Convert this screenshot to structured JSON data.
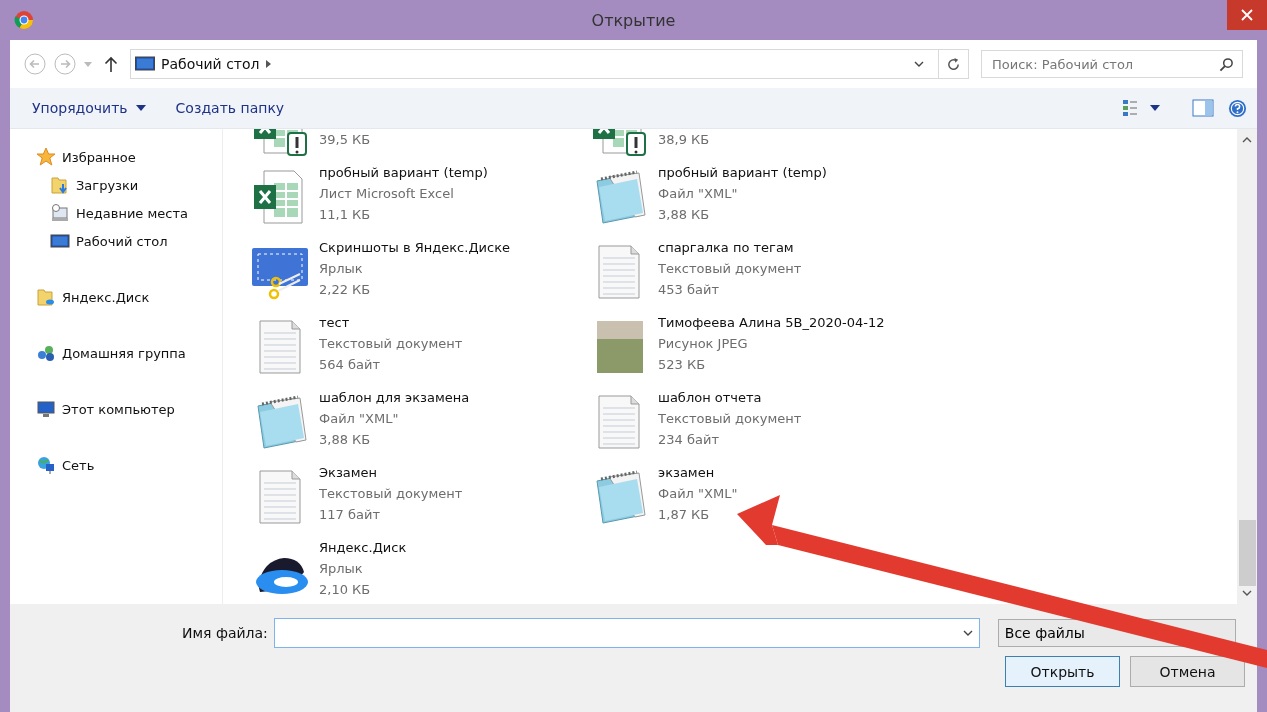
{
  "window": {
    "title": "Открытие"
  },
  "nav": {
    "path": "Рабочий стол",
    "search": {
      "placeholder": "Поиск: Рабочий стол"
    }
  },
  "toolbar": {
    "buttons": [
      {
        "label": "Упорядочить",
        "kind": "menu"
      },
      {
        "label": "Создать папку",
        "kind": "plain"
      }
    ]
  },
  "sidebar": {
    "items": [
      {
        "label": "Избранное",
        "kind": "star",
        "children": [
          {
            "label": "Загрузки",
            "kind": "downloads"
          },
          {
            "label": "Недавние места",
            "kind": "recent"
          },
          {
            "label": "Рабочий стол",
            "kind": "desktop"
          }
        ]
      },
      {
        "label": "Яндекс.Диск",
        "kind": "cloudfolder"
      },
      {
        "label": "Домашняя группа",
        "kind": "homegroup"
      },
      {
        "label": "Этот компьютер",
        "kind": "computer"
      },
      {
        "label": "Сеть",
        "kind": "network"
      }
    ]
  },
  "files": [
    {
      "kind": "excel-warning",
      "size": "39,5 КБ"
    },
    {
      "kind": "excel-warning",
      "size": "38,9 КБ"
    },
    {
      "kind": "excel",
      "name": "пробный вариант (temp)",
      "type": "Лист Microsoft Excel",
      "size": "11,1 КБ"
    },
    {
      "kind": "xml",
      "name": "пробный вариант (temp)",
      "type": "Файл \"XML\"",
      "size": "3,88 КБ"
    },
    {
      "kind": "screenshot-shortcut",
      "name": "Скриншоты в Яндекс.Диске",
      "type": "Ярлык",
      "size": "2,22 КБ"
    },
    {
      "kind": "text",
      "name": "спаргалка по тегам",
      "type": "Текстовый документ",
      "size": "453 байт"
    },
    {
      "kind": "text",
      "name": "тест",
      "type": "Текстовый документ",
      "size": "564 байт"
    },
    {
      "kind": "image",
      "name": "Тимофеева Алина 5В_2020-04-12",
      "type": "Рисунок JPEG",
      "size": "523 КБ"
    },
    {
      "kind": "xml",
      "name": "шаблон для экзамена",
      "type": "Файл \"XML\"",
      "size": "3,88 КБ"
    },
    {
      "kind": "text",
      "name": "шаблон отчета",
      "type": "Текстовый документ",
      "size": "234 байт"
    },
    {
      "kind": "text",
      "name": "Экзамен",
      "type": "Текстовый документ",
      "size": "117 байт"
    },
    {
      "kind": "xml",
      "name": "экзамен",
      "type": "Файл \"XML\"",
      "size": "1,87 КБ"
    },
    {
      "kind": "disk-shortcut",
      "name": "Яндекс.Диск",
      "type": "Ярлык",
      "size": "2,10 КБ"
    }
  ],
  "footer": {
    "filename_label": "Имя файла:",
    "filter": "Все файлы",
    "buttons": [
      {
        "label": "Открыть",
        "kind": "primary"
      },
      {
        "label": "Отмена",
        "kind": "normal"
      }
    ]
  }
}
